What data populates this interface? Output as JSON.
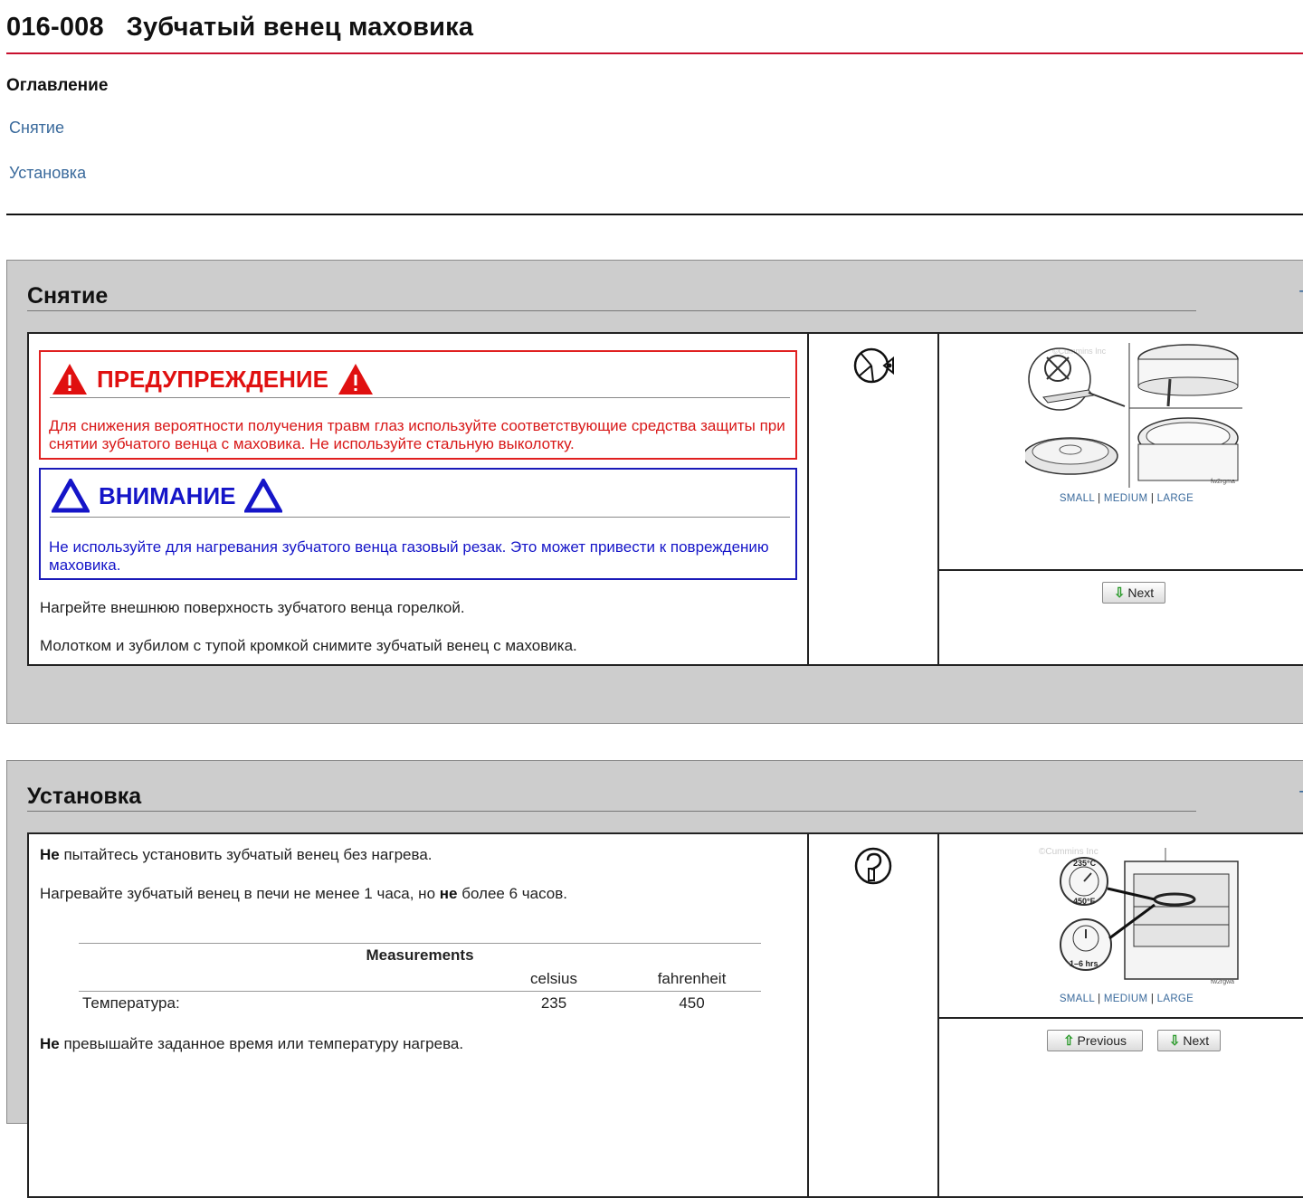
{
  "page": {
    "title": "016-008   Зубчатый венец маховика"
  },
  "toc": {
    "heading": "Оглавление",
    "items": [
      {
        "label": "Снятие"
      },
      {
        "label": "Установка"
      }
    ]
  },
  "removal": {
    "title": "Снятие",
    "top_link": "T",
    "warning": {
      "title": "ПРЕДУПРЕЖДЕНИЕ",
      "text": "Для снижения вероятности получения травм глаз используйте соответствующие средства защиты при снятии зубчатого венца с маховика. Не используйте стальную выколотку."
    },
    "caution": {
      "title": "ВНИМАНИЕ",
      "text": "Не используйте для нагревания зубчатого венца газовый резак. Это может привести к повреждению маховика."
    },
    "steps": [
      "Нагрейте внешнюю поверхность зубчатого венца горелкой.",
      "Молотком и зубилом с тупой кромкой снимите зубчатый венец с маховика."
    ],
    "image": {
      "watermark": "©Cummins Inc",
      "code": "fw2rgma"
    },
    "size_links": {
      "small": "SMALL",
      "medium": "MEDIUM",
      "large": "LARGE",
      "sep": "|"
    },
    "next_label": "Next"
  },
  "install": {
    "title": "Установка",
    "top_link": "T",
    "step1_bold": "Не",
    "step1_rest": " пытайтесь установить зубчатый венец без нагрева.",
    "step2_pre": "Нагревайте зубчатый венец в печи не менее 1 часа, но ",
    "step2_bold": "не",
    "step2_post": " более 6 часов.",
    "measurements": {
      "title": "Measurements",
      "col1": "celsius",
      "col2": "fahrenheit",
      "row_label": "Температура:",
      "celsius": "235",
      "fahrenheit": "450"
    },
    "step3_bold": "Не",
    "step3_rest": " превышайте заданное время или температуру нагрева.",
    "image": {
      "watermark": "©Cummins Inc",
      "temp_c": "235°C",
      "temp_f": "450°F",
      "time": "1–6 hrs",
      "code": "fw2rgwa"
    },
    "size_links": {
      "small": "SMALL",
      "medium": "MEDIUM",
      "large": "LARGE",
      "sep": "|"
    },
    "previous_label": "Previous",
    "next_label": "Next"
  },
  "colors": {
    "accent_rule": "#c8102e",
    "warning": "#e01010",
    "caution": "#1515c8",
    "link": "#3a6a9c",
    "section_bg": "#cdcdcd"
  },
  "icons": {
    "removal_step": "eye-protection-icon",
    "install_step": "hook-tool-icon"
  }
}
